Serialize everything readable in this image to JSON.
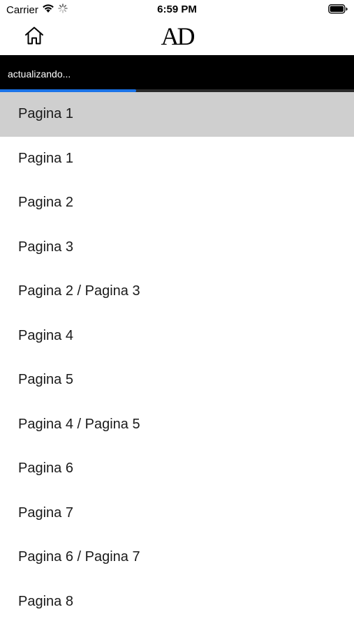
{
  "status_bar": {
    "carrier": "Carrier",
    "time": "6:59 PM",
    "wifi_icon": "wifi-icon",
    "activity_icon": "activity-spinner-icon",
    "battery_icon": "battery-icon"
  },
  "nav": {
    "home_icon": "home-icon",
    "logo_text": "AD"
  },
  "update_banner": {
    "text": "actualizando...",
    "progress": 0.385,
    "progress_color": "#1a73e8"
  },
  "pages": {
    "items": [
      {
        "label": "Pagina 1",
        "selected": true
      },
      {
        "label": "Pagina 1",
        "selected": false
      },
      {
        "label": "Pagina 2",
        "selected": false
      },
      {
        "label": "Pagina 3",
        "selected": false
      },
      {
        "label": "Pagina 2 / Pagina 3",
        "selected": false
      },
      {
        "label": "Pagina 4",
        "selected": false
      },
      {
        "label": "Pagina 5",
        "selected": false
      },
      {
        "label": "Pagina 4 / Pagina 5",
        "selected": false
      },
      {
        "label": "Pagina 6",
        "selected": false
      },
      {
        "label": "Pagina 7",
        "selected": false
      },
      {
        "label": "Pagina 6 / Pagina 7",
        "selected": false
      },
      {
        "label": "Pagina 8",
        "selected": false
      }
    ]
  }
}
